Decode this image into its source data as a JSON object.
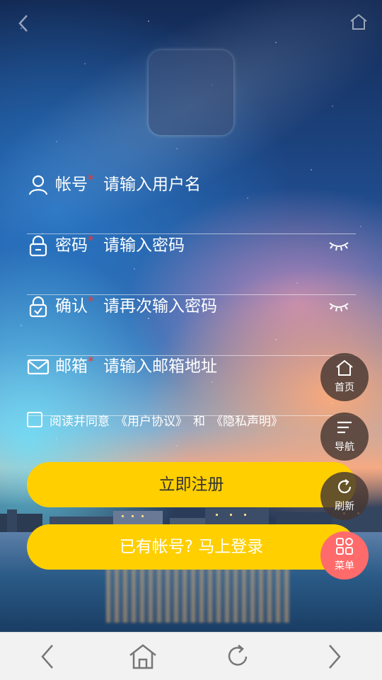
{
  "header": {
    "back_icon": "chevron-left-icon",
    "home_icon": "home-icon"
  },
  "form": {
    "username": {
      "label": "帐号",
      "required_mark": "*",
      "placeholder": "请输入用户名",
      "icon": "user-icon"
    },
    "password": {
      "label": "密码",
      "required_mark": "*",
      "placeholder": "请输入密码",
      "icon": "lock-icon"
    },
    "confirm": {
      "label": "确认",
      "required_mark": "*",
      "placeholder": "请再次输入密码",
      "icon": "lock-check-icon"
    },
    "email": {
      "label": "邮箱",
      "required_mark": "*",
      "placeholder": "请输入邮箱地址",
      "icon": "mail-icon"
    },
    "agreement": {
      "text": "阅读并同意",
      "user_agreement": "《用户协议》",
      "and": "和",
      "privacy": "《隐私声明》"
    },
    "register_button": "立即注册",
    "login_button": "已有帐号? 马上登录"
  },
  "floating_menu": [
    {
      "label": "首页",
      "icon": "home-icon"
    },
    {
      "label": "导航",
      "icon": "menu-lines-icon"
    },
    {
      "label": "刷新",
      "icon": "refresh-icon"
    },
    {
      "label": "菜单",
      "icon": "grid-icon"
    }
  ],
  "colors": {
    "accent": "#ffcf00",
    "menu_button": "#ff6b6b",
    "required": "#e23b3b"
  }
}
